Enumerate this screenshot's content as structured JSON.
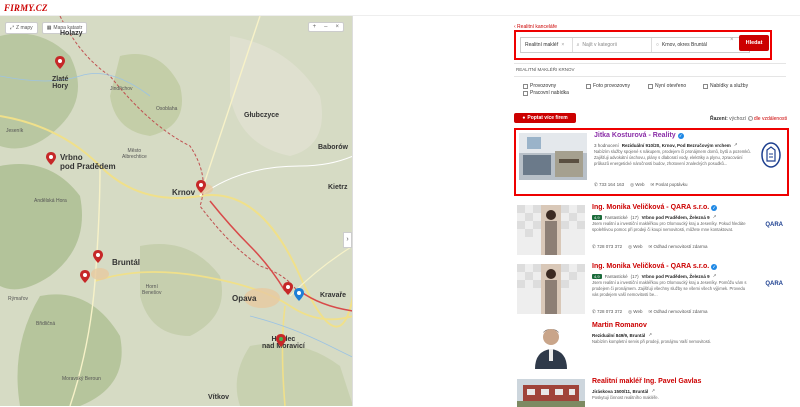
{
  "header": {
    "logo": "FIRMY.CZ"
  },
  "map": {
    "toolbar": {
      "zoom_out": "Z mapy",
      "fit": "Mapa katastr"
    },
    "ctrl": {
      "a": "+",
      "b": "–",
      "c": "×"
    },
    "arrow": "›",
    "labels": [
      {
        "id": "holazy",
        "text": "Holazy"
      },
      {
        "id": "zlate-hory",
        "text": "Zlaté\nHory"
      },
      {
        "id": "vrbno",
        "text": "Vrbno\npod Pradědem"
      },
      {
        "id": "krnov",
        "text": "Krnov"
      },
      {
        "id": "mesto-albrechtice",
        "text": "Město\nAlbrechtice"
      },
      {
        "id": "osoblaha",
        "text": "Osoblaha"
      },
      {
        "id": "glubczyce",
        "text": "Głubczyce"
      },
      {
        "id": "baborow",
        "text": "Baborów"
      },
      {
        "id": "kietrz",
        "text": "Kietrz"
      },
      {
        "id": "bruntal",
        "text": "Bruntál"
      },
      {
        "id": "opava",
        "text": "Opava"
      },
      {
        "id": "kravare",
        "text": "Kravaře"
      },
      {
        "id": "hradec",
        "text": "Hradec\nnad Moravicí"
      },
      {
        "id": "vitkov",
        "text": "Vítkov"
      },
      {
        "id": "rymarov",
        "text": "Rýmařov"
      },
      {
        "id": "horni-benesov",
        "text": "Horní\nBenešov"
      },
      {
        "id": "andelska-hora",
        "text": "Andělská Hora"
      },
      {
        "id": "bridlicna",
        "text": "Břidličná"
      },
      {
        "id": "moravsky-beroun",
        "text": "Moravský Beroun"
      },
      {
        "id": "jindrichov",
        "text": "Jindřichov"
      },
      {
        "id": "jeseník",
        "text": "Jeseník"
      }
    ]
  },
  "search": {
    "back": "‹ Realitní kanceláře",
    "what": "Realitní makléř",
    "what_clear": "×",
    "category_placeholder": "Najít v kategorii",
    "where": "Krnov, okres Bruntál",
    "button": "Hledat"
  },
  "filters": {
    "title": "REALITNÍ MAKLÉŘI KRNOV",
    "items": [
      "Provozovny",
      "Foto provozovny",
      "Nyní otevřeno",
      "Nabídky a služby",
      "Pracovní nabídka"
    ]
  },
  "ask_button": "Poptat více firem",
  "sort": {
    "label": "Řazení:",
    "value": "výchozí",
    "info": "i",
    "link": "dle vzdálenosti"
  },
  "results": [
    {
      "title": "Jitka Kosturová - Reality",
      "rating": "3 hodnocení",
      "address": "Reziduální 910/20, Krnov, Pod Bezručovým vrchem",
      "desc": "Nabízím služby spojené s nákupem, prodejem či pronájmem domů, bytů a pozemků. Zajišťuji advokátní úschovu, plány s dlaboratí vody, elektriky a plynu, zpracování průkazů energetické náročnosti budov, zhotovení znaleckých posudků...",
      "phone": "733 164 163",
      "web": "Web",
      "extra": "Poslat poptávku"
    },
    {
      "title": "Ing. Monika Veličková - QARA s.r.o.",
      "rating": "Fantastické",
      "rating_count": "(17)",
      "address": "Vrbno pod Pradědem, Železná 9",
      "desc": "Jsem realitní a investiční makléřkou pro Olomoucký kraj a Jeseníky. Pokud hledáte spolehlivou pomoc při prodeji či koupi nemovitosti, můžete mne kontaktovat.",
      "phone": "728 073 372",
      "web": "Web",
      "extra": "Odhad nemovitostí zdarma",
      "logo": "QARA"
    },
    {
      "title": "Ing. Monika Veličková - QARA s.r.o.",
      "rating": "Fantastické",
      "rating_count": "(17)",
      "address": "Vrbno pod Pradědem, Železná 9",
      "desc": "Jsem realitní a investiční makléřkou pro Olomoucký kraj a Jeseníky. Pomůžu vám s prodejem či pronájmem. Zajišťuji všechny služby se všemi všech výjimek. Provedu vás prodejem vaší nemovitosti be...",
      "phone": "728 073 372",
      "web": "Web",
      "extra": "Odhad nemovitostí zdarma",
      "logo": "QARA"
    },
    {
      "title": "Martin Romanov",
      "address": "Reziduální 849/9, Bruntál",
      "desc": "Nabízím kompletní servis při prodeji, pronájmu Vaší nemovitosti."
    },
    {
      "title": "Realitní makléř Ing. Pavel Gavlas",
      "address": "Jiráskova 1500/11, Bruntál",
      "desc": "Poskytuji činnost realitního makléře."
    }
  ]
}
